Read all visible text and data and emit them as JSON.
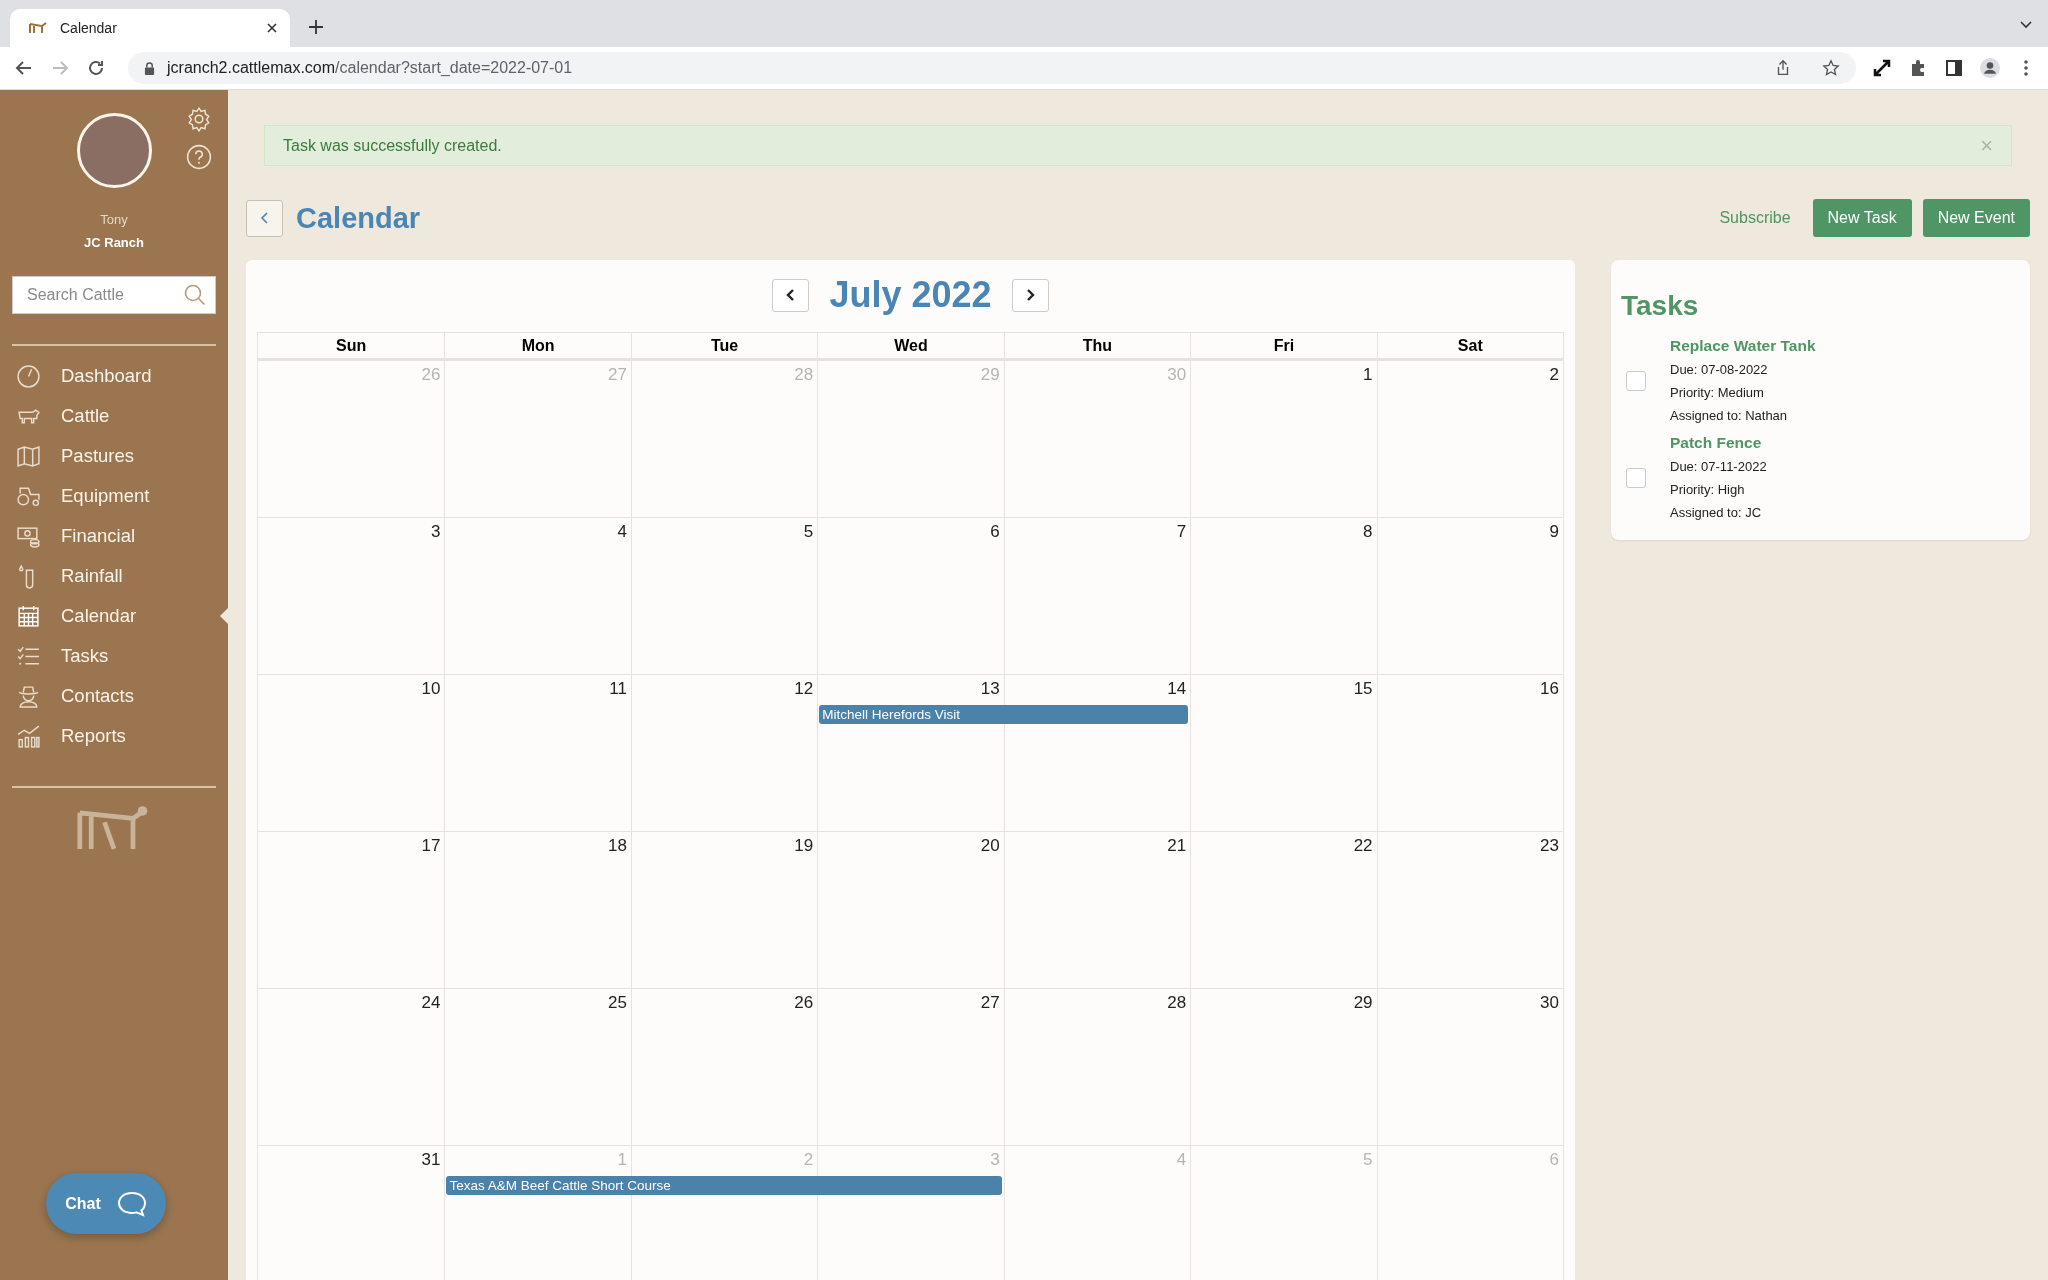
{
  "browser": {
    "tab_title": "Calendar",
    "url_host": "jcranch2.cattlemax.com",
    "url_path": "/calendar?start_date=2022-07-01"
  },
  "sidebar": {
    "user_name": "Tony",
    "ranch_name": "JC Ranch",
    "search": {
      "placeholder": "Search Cattle"
    },
    "items": [
      {
        "label": "Dashboard",
        "selected": false
      },
      {
        "label": "Cattle",
        "selected": false
      },
      {
        "label": "Pastures",
        "selected": false
      },
      {
        "label": "Equipment",
        "selected": false
      },
      {
        "label": "Financial",
        "selected": false
      },
      {
        "label": "Rainfall",
        "selected": false
      },
      {
        "label": "Calendar",
        "selected": true
      },
      {
        "label": "Tasks",
        "selected": false
      },
      {
        "label": "Contacts",
        "selected": false
      },
      {
        "label": "Reports",
        "selected": false
      }
    ],
    "chat_button": "Chat"
  },
  "alert": {
    "message": "Task was successfully created.",
    "close": "×"
  },
  "header": {
    "title": "Calendar",
    "subscribe": "Subscribe",
    "buttons": [
      "New Task",
      "New Event"
    ]
  },
  "calendar": {
    "month": "July 2022",
    "weekdays": [
      "Sun",
      "Mon",
      "Tue",
      "Wed",
      "Thu",
      "Fri",
      "Sat"
    ],
    "weeks": [
      {
        "days": [
          {
            "label": "26",
            "in_month": false
          },
          {
            "label": "27",
            "in_month": false
          },
          {
            "label": "28",
            "in_month": false
          },
          {
            "label": "29",
            "in_month": false
          },
          {
            "label": "30",
            "in_month": false
          },
          {
            "label": "1",
            "in_month": true
          },
          {
            "label": "2",
            "in_month": true
          }
        ]
      },
      {
        "days": [
          {
            "label": "3",
            "in_month": true
          },
          {
            "label": "4",
            "in_month": true
          },
          {
            "label": "5",
            "in_month": true
          },
          {
            "label": "6",
            "in_month": true
          },
          {
            "label": "7",
            "in_month": true
          },
          {
            "label": "8",
            "in_month": true
          },
          {
            "label": "9",
            "in_month": true
          }
        ]
      },
      {
        "days": [
          {
            "label": "10",
            "in_month": true
          },
          {
            "label": "11",
            "in_month": true
          },
          {
            "label": "12",
            "in_month": true
          },
          {
            "label": "13",
            "in_month": true,
            "events": [
              {
                "title": "Mitchell Herefords Visit"
              }
            ]
          },
          {
            "label": "14",
            "in_month": true,
            "event_continues": true
          },
          {
            "label": "15",
            "in_month": true
          },
          {
            "label": "16",
            "in_month": true
          }
        ]
      },
      {
        "days": [
          {
            "label": "17",
            "in_month": true
          },
          {
            "label": "18",
            "in_month": true
          },
          {
            "label": "19",
            "in_month": true
          },
          {
            "label": "20",
            "in_month": true
          },
          {
            "label": "21",
            "in_month": true
          },
          {
            "label": "22",
            "in_month": true
          },
          {
            "label": "23",
            "in_month": true
          }
        ]
      },
      {
        "days": [
          {
            "label": "24",
            "in_month": true
          },
          {
            "label": "25",
            "in_month": true
          },
          {
            "label": "26",
            "in_month": true
          },
          {
            "label": "27",
            "in_month": true
          },
          {
            "label": "28",
            "in_month": true
          },
          {
            "label": "29",
            "in_month": true
          },
          {
            "label": "30",
            "in_month": true
          }
        ]
      },
      {
        "days": [
          {
            "label": "31",
            "in_month": true
          },
          {
            "label": "1",
            "in_month": false,
            "events": [
              {
                "title": "Texas A&M Beef Cattle Short Course"
              }
            ]
          },
          {
            "label": "2",
            "in_month": false,
            "event_continues": true
          },
          {
            "label": "3",
            "in_month": false,
            "event_continues": true
          },
          {
            "label": "4",
            "in_month": false
          },
          {
            "label": "5",
            "in_month": false
          },
          {
            "label": "6",
            "in_month": false
          }
        ]
      }
    ]
  },
  "tasks": {
    "title": "Tasks",
    "items": [
      {
        "name": "Replace Water Tank",
        "due": "Due: 07-08-2022",
        "priority": "Priority: Medium",
        "assigned": "Assigned to: Nathan",
        "checked": false
      },
      {
        "name": "Patch Fence",
        "due": "Due: 07-11-2022",
        "priority": "Priority: High",
        "assigned": "Assigned to: JC",
        "checked": false
      }
    ]
  }
}
